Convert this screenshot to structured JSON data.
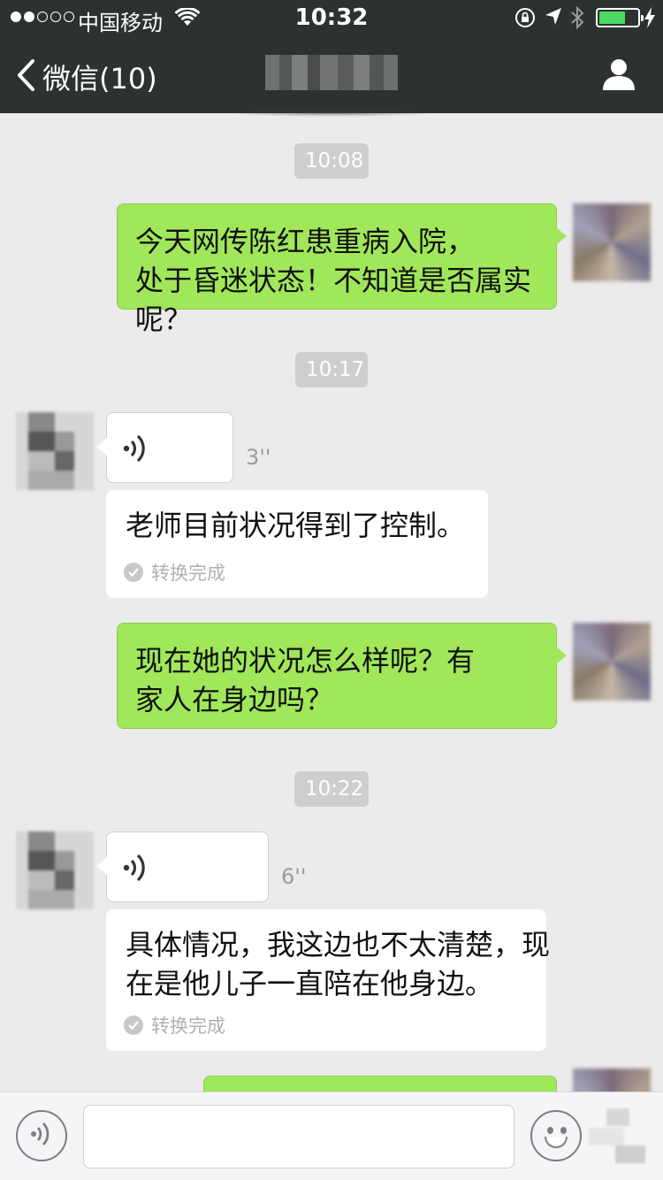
{
  "status_bar": {
    "carrier": "中国移动",
    "time": "10:32",
    "battery_level": 0.7,
    "colors": {
      "battery": "#4cd964"
    }
  },
  "nav": {
    "back_label": "微信(10)",
    "title": "",
    "icons": {
      "back": "chevron-left-icon",
      "profile": "person-icon"
    }
  },
  "messages": [
    {
      "type": "time",
      "text": "10:08"
    },
    {
      "type": "text",
      "from": "me",
      "text": "今天网传陈红患重病入院，处于昏迷状态！不知道是否属实呢？"
    },
    {
      "type": "time",
      "text": "10:17"
    },
    {
      "type": "voice",
      "from": "other",
      "duration": "3''",
      "transcript": "老师目前状况得到了控制。",
      "status": "转换完成"
    },
    {
      "type": "text",
      "from": "me",
      "text": "现在她的状况怎么样呢？有家人在身边吗？"
    },
    {
      "type": "time",
      "text": "10:22"
    },
    {
      "type": "voice",
      "from": "other",
      "duration": "6''",
      "transcript": "具体情况，我这边也不太清楚，现在是他儿子一直陪在他身边。",
      "status": "转换完成"
    }
  ],
  "input_bar": {
    "placeholder": "",
    "icons": {
      "voice": "voice-toggle-icon",
      "emoji": "emoji-icon"
    }
  },
  "colors": {
    "bubble_me": "#a0e75a",
    "bubble_other": "#ffffff",
    "background": "#ebebeb",
    "navbar": "#2e3132"
  }
}
